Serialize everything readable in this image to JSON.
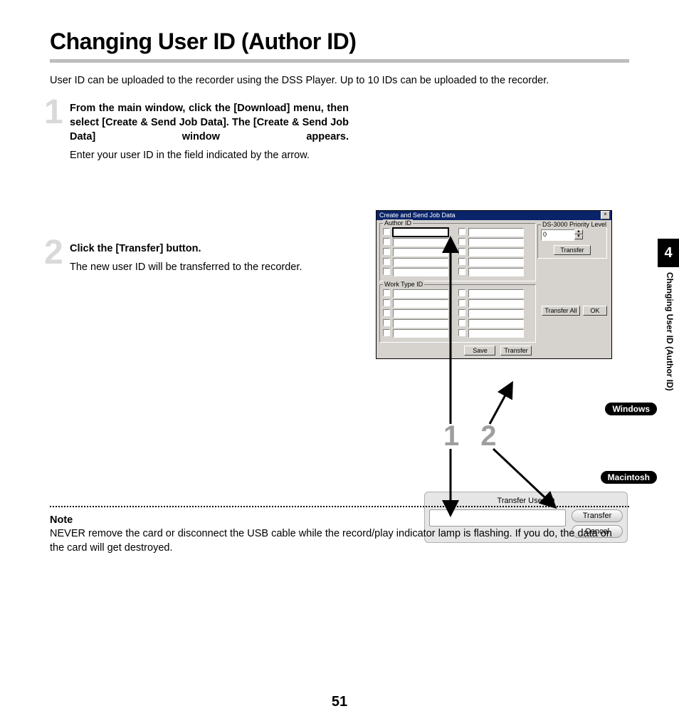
{
  "page": {
    "title": "Changing User ID (Author ID)",
    "intro": "User ID can be uploaded to the recorder using the DSS Player. Up to 10 IDs can be uploaded to the recorder.",
    "chapter_number": "4",
    "side_text": "Changing User ID (Author ID)",
    "page_number": "51"
  },
  "steps": [
    {
      "num": "1",
      "head": "From the main window, click the [Download] menu, then select [Create & Send Job Data]. The [Create & Send Job Data] window appears.",
      "body": "Enter your user ID in the field indicated by the arrow."
    },
    {
      "num": "2",
      "head": "Click the [Transfer] button.",
      "body": "The new user ID will be transferred to the recorder."
    }
  ],
  "callouts": {
    "n1": "1",
    "n2": "2"
  },
  "os": {
    "windows": "Windows",
    "macintosh": "Macintosh"
  },
  "win": {
    "title": "Create and Send Job Data",
    "close_glyph": "×",
    "group_author": "Author ID",
    "group_work": "Work Type ID",
    "priority_label": "DS-3000 Priority Level",
    "priority_value": "0",
    "up_glyph": "▲",
    "down_glyph": "▼",
    "btn_transfer_small": "Transfer",
    "btn_save": "Save",
    "btn_transfer": "Transfer",
    "btn_transfer_all": "Transfer All",
    "btn_ok": "OK"
  },
  "mac": {
    "title": "Transfer User ID",
    "btn_transfer": "Transfer",
    "btn_cancel": "Cancel"
  },
  "note": {
    "head": "Note",
    "body": "NEVER remove the card or disconnect the USB cable while the record/play indicator lamp is flashing. If you do, the data on the card will get destroyed."
  }
}
